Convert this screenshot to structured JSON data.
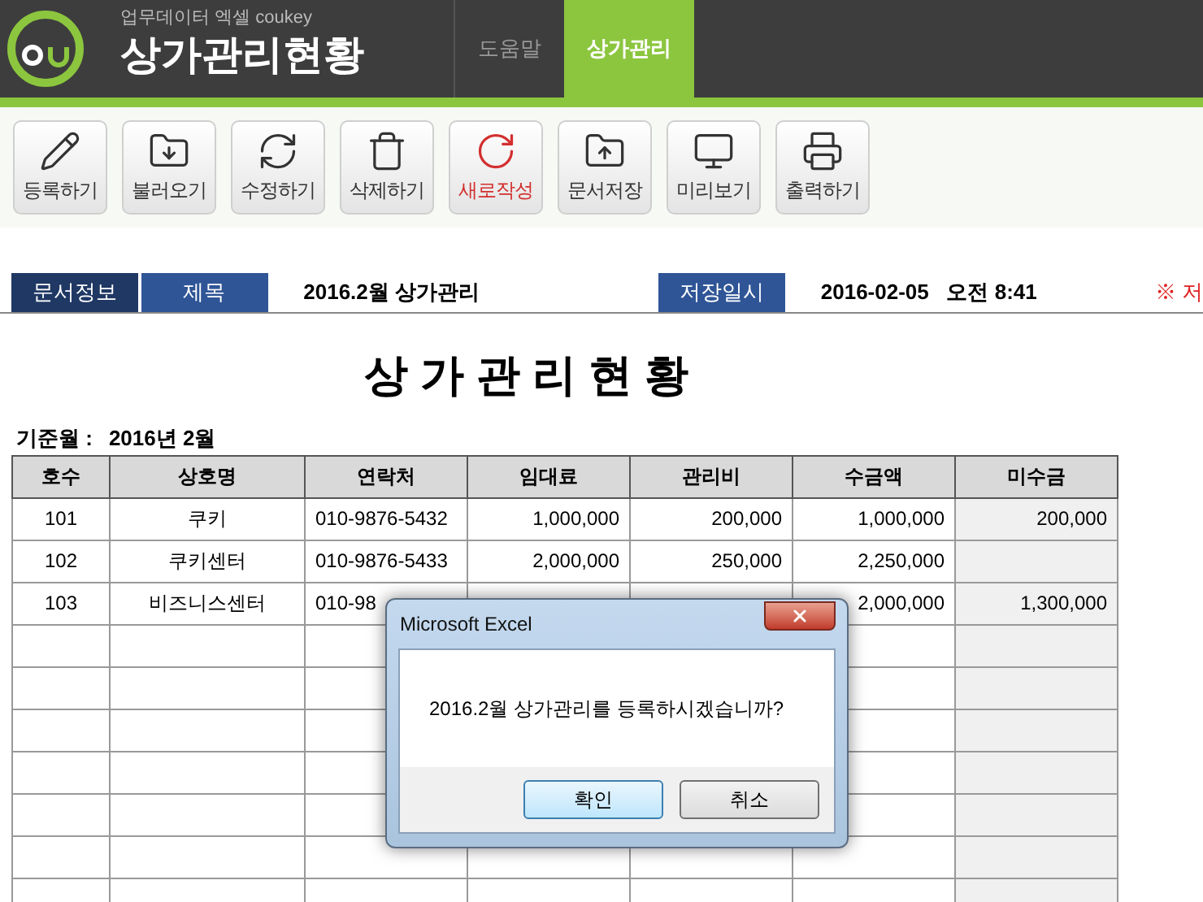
{
  "header": {
    "subtitle": "업무데이터 엑셀 coukey",
    "title": "상가관리현황",
    "tabs": [
      {
        "label": "도움말",
        "selected": false
      },
      {
        "label": "상가관리",
        "selected": true
      }
    ]
  },
  "toolbar": [
    {
      "label": "등록하기",
      "kind": "normal"
    },
    {
      "label": "불러오기",
      "kind": "normal"
    },
    {
      "label": "수정하기",
      "kind": "normal"
    },
    {
      "label": "삭제하기",
      "kind": "normal"
    },
    {
      "label": "새로작성",
      "kind": "accent"
    },
    {
      "label": "문서저장",
      "kind": "normal"
    },
    {
      "label": "미리보기",
      "kind": "normal"
    },
    {
      "label": "출력하기",
      "kind": "normal"
    }
  ],
  "info_bar": {
    "section_label": "문서정보",
    "title_label": "제목",
    "title_value": "2016.2월 상가관리",
    "saved_label": "저장일시",
    "saved_value": "2016-02-05   오전 8:41",
    "note": "※ 저"
  },
  "sheet": {
    "heading": "상 가 관 리 현 황",
    "month_label": "기준월 :",
    "month_value": "2016년 2월",
    "columns": [
      "호수",
      "상호명",
      "연락처",
      "임대료",
      "관리비",
      "수금액",
      "미수금"
    ],
    "rows": [
      [
        "101",
        "쿠키",
        "010-9876-5432",
        "1,000,000",
        "200,000",
        "1,000,000",
        "200,000"
      ],
      [
        "102",
        "쿠키센터",
        "010-9876-5433",
        "2,000,000",
        "250,000",
        "2,250,000",
        null
      ],
      [
        "103",
        "비즈니스센터",
        "010-98",
        null,
        null,
        "2,000,000",
        "1,300,000"
      ]
    ]
  },
  "dialog": {
    "title": "Microsoft Excel",
    "message": "2016.2월 상가관리를 등록하시겠습니까?",
    "buttons": [
      {
        "label": "확인",
        "selected": true
      },
      {
        "label": "취소",
        "selected": false
      }
    ]
  }
}
